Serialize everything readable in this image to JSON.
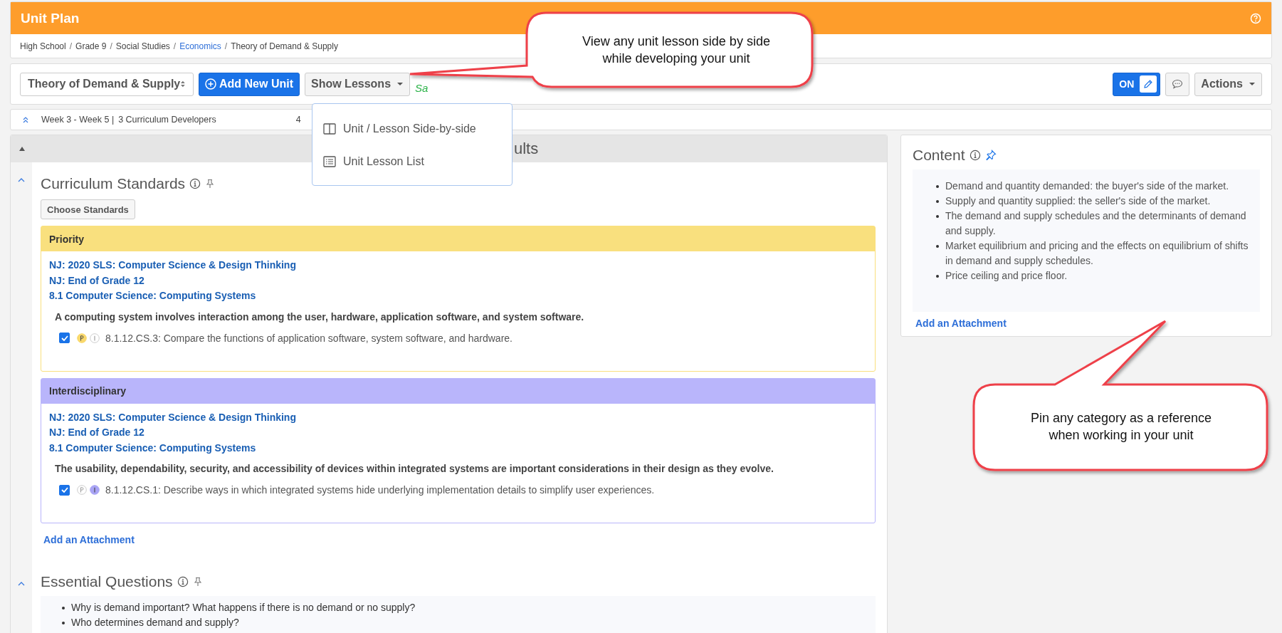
{
  "header": {
    "title": "Unit Plan"
  },
  "breadcrumb": [
    {
      "label": "High School",
      "link": false
    },
    {
      "separator": "/",
      "label": "Grade 9",
      "link": false
    },
    {
      "separator": "/",
      "label": "Social Studies",
      "link": false
    },
    {
      "separator": "/",
      "label": "Economics",
      "link": true
    },
    {
      "separator": "/",
      "label": "Theory of Demand & Supply",
      "link": false
    }
  ],
  "toolbar": {
    "unit_select": "Theory of Demand & Supply",
    "add_button": "Add New Unit",
    "show_lessons": "Show Lessons",
    "status": "Sa",
    "edit_toggle": {
      "label": "ON",
      "on": true
    },
    "actions": "Actions"
  },
  "lessons_menu": [
    {
      "label": "Unit / Lesson Side-by-side",
      "kind": "columns"
    },
    {
      "label": "Unit Lesson List",
      "kind": "list"
    }
  ],
  "info_bar": {
    "weeks": "Week 3 - Week 5 |",
    "developers": "3 Curriculum Developers",
    "column_3": "4"
  },
  "main": {
    "stage_title": "ults",
    "standards": {
      "title": "Curriculum Standards",
      "pinned": false,
      "button": "Choose Standards",
      "attachment": "Add an Attachment",
      "groups": [
        {
          "title": "Priority",
          "color": "#f9e07e",
          "links": [
            "NJ: 2020 SLS: Computer Science & Design Thinking",
            "NJ: End of Grade 12",
            "8.1 Computer Science: Computing Systems"
          ],
          "description": "A computing system involves interaction among the user, hardware, application software, and system software.",
          "items": [
            {
              "checked": true,
              "priority": true,
              "interdisciplinary": false,
              "text": "8.1.12.CS.3: Compare the functions of application software, system software, and hardware."
            }
          ]
        },
        {
          "title": "Interdisciplinary",
          "color": "#b9b5fb",
          "links": [
            "NJ: 2020 SLS: Computer Science & Design Thinking",
            "NJ: End of Grade 12",
            "8.1 Computer Science: Computing Systems"
          ],
          "description": "The usability, dependability, security, and accessibility of devices within integrated systems are important considerations in their design as they evolve.",
          "items": [
            {
              "checked": true,
              "priority": false,
              "interdisciplinary": true,
              "text": "8.1.12.CS.1: Describe ways in which integrated systems hide underlying implementation details to simplify user experiences."
            }
          ]
        }
      ]
    },
    "questions": {
      "title": "Essential Questions",
      "pinned": false,
      "items": [
        "Why is demand important? What happens if there is no demand or no supply?",
        "Who determines demand and supply?"
      ]
    }
  },
  "content": {
    "title": "Content",
    "pinned": true,
    "items": [
      "Demand and quantity demanded: the buyer's side of the market.",
      "Supply and quantity supplied: the seller's side of the market.",
      "The demand and supply schedules and the determinants of demand and supply.",
      "Market equilibrium and pricing and the effects on equilibrium of shifts in demand and supply schedules.",
      "Price ceiling and price floor."
    ],
    "attachment": "Add an Attachment"
  },
  "callouts": [
    {
      "text": "View any unit lesson side by side\nwhile developing your unit",
      "kind": "top"
    },
    {
      "text": "Pin any category as a reference\nwhen working in your unit",
      "kind": "bottom"
    }
  ]
}
